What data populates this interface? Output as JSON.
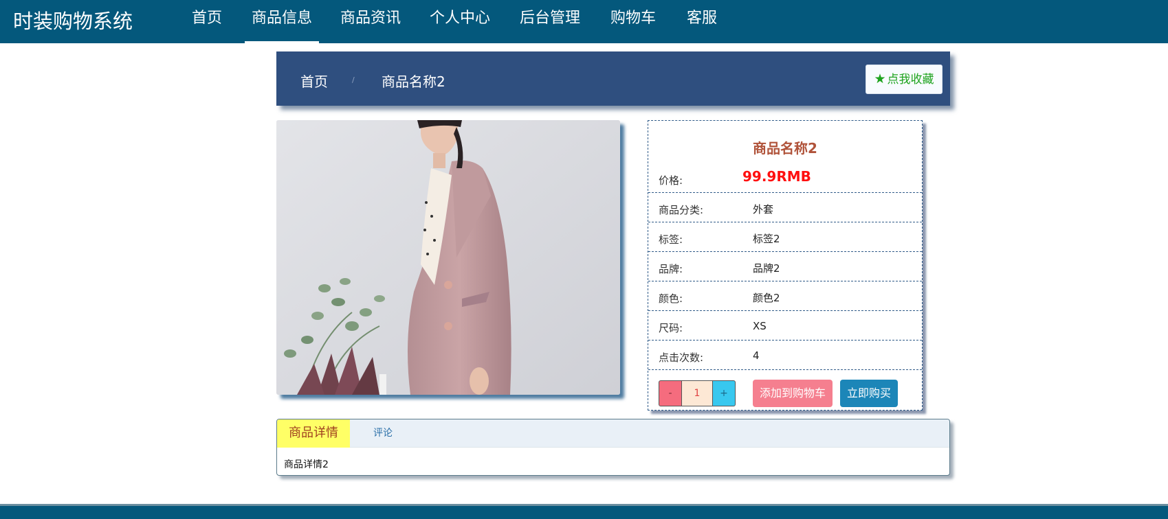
{
  "header": {
    "brand": "时装购物系统",
    "nav": [
      {
        "label": "首页",
        "active": false
      },
      {
        "label": "商品信息",
        "active": true
      },
      {
        "label": "商品资讯",
        "active": false
      },
      {
        "label": "个人中心",
        "active": false
      },
      {
        "label": "后台管理",
        "active": false
      },
      {
        "label": "购物车",
        "active": false
      },
      {
        "label": "客服",
        "active": false
      }
    ]
  },
  "breadcrumb": {
    "home": "首页",
    "separator": "/",
    "current": "商品名称2",
    "favorite_label": "点我收藏",
    "favorite_icon": "star-icon"
  },
  "product": {
    "title": "商品名称2",
    "price_label": "价格:",
    "price": "99.9RMB",
    "fields": [
      {
        "label": "商品分类:",
        "value": "外套"
      },
      {
        "label": "标签:",
        "value": "标签2"
      },
      {
        "label": "品牌:",
        "value": "品牌2"
      },
      {
        "label": "颜色:",
        "value": "颜色2"
      },
      {
        "label": "尺码:",
        "value": "XS"
      },
      {
        "label": "点击次数:",
        "value": "4"
      }
    ],
    "quantity": {
      "minus": "-",
      "value": "1",
      "plus": "+"
    },
    "add_to_cart": "添加到购物车",
    "buy_now": "立即购买"
  },
  "tabs": {
    "items": [
      {
        "label": "商品详情",
        "active": true
      },
      {
        "label": "评论",
        "active": false
      }
    ],
    "content": "商品详情2"
  },
  "colors": {
    "header_bg": "#04587c",
    "breadcrumb_bg": "#2f4f7f",
    "price": "#ff1010",
    "title": "#b0533a",
    "cart_button": "#f57f8f",
    "buy_button": "#1c86b8",
    "favorite_text": "#1ea31e",
    "active_tab_bg": "#ffff66"
  }
}
